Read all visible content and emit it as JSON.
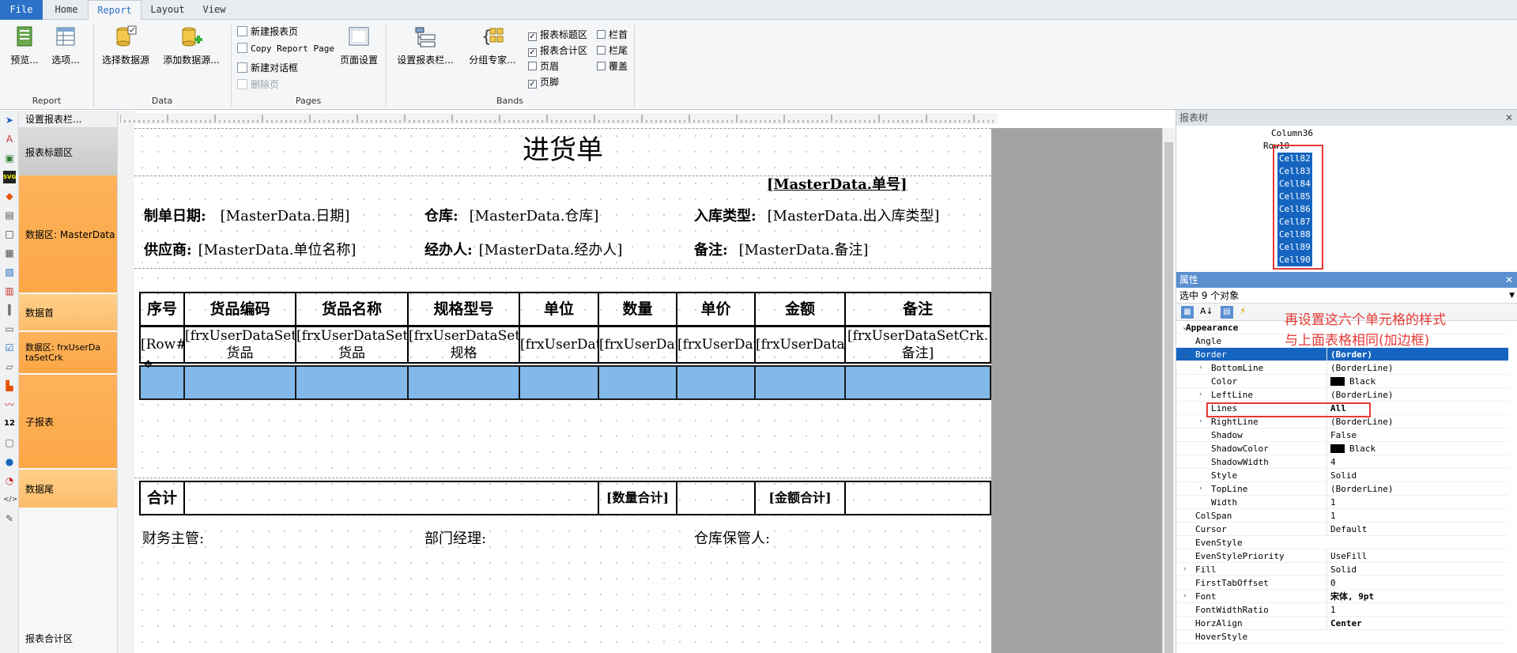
{
  "tabs": [
    {
      "label": "File",
      "state": "file"
    },
    {
      "label": "Home",
      "state": ""
    },
    {
      "label": "Report",
      "state": "active"
    },
    {
      "label": "Layout",
      "state": ""
    },
    {
      "label": "View",
      "state": ""
    }
  ],
  "ribbon": {
    "report_group": {
      "label": "Report",
      "preview": "预览...",
      "options": "选项..."
    },
    "data_group": {
      "label": "Data",
      "select_ds": "选择数据源",
      "add_ds": "添加数据源..."
    },
    "pages_group": {
      "label": "Pages",
      "new_page": "新建报表页",
      "copy_page": "Copy Report Page",
      "new_dialog": "新建对话框",
      "delete_page": "删除页",
      "page_setup": "页面设置"
    },
    "bands_group": {
      "label": "Bands",
      "config_bands": "设置报表栏...",
      "group_expert": "分组专家...",
      "checks": [
        {
          "label": "报表标题区",
          "checked": true
        },
        {
          "label": "报表合计区",
          "checked": true
        },
        {
          "label": "页眉",
          "checked": false
        },
        {
          "label": "页脚",
          "checked": true
        },
        {
          "label": "栏首",
          "checked": false
        },
        {
          "label": "栏尾",
          "checked": false
        },
        {
          "label": "覆盖",
          "checked": false
        }
      ]
    }
  },
  "bands_panel": {
    "header": "设置报表栏...",
    "items": [
      "报表标题区",
      "数据区: MasterData",
      "数据首",
      "数据区: frxUserDataSetCrk",
      "子报表",
      "数据尾",
      "报表合计区"
    ]
  },
  "report": {
    "title": "进货单",
    "order_no": "[MasterData.单号]",
    "row1": [
      {
        "label": "制单日期:",
        "value": "[MasterData.日期]"
      },
      {
        "label": "仓库:",
        "value": "[MasterData.仓库]"
      },
      {
        "label": "入库类型:",
        "value": "[MasterData.出入库类型]"
      }
    ],
    "row2": [
      {
        "label": "供应商:",
        "value": "[MasterData.单位名称]"
      },
      {
        "label": "经办人:",
        "value": "[MasterData.经办人]"
      },
      {
        "label": "备注:",
        "value": "[MasterData.备注]"
      }
    ],
    "headers": [
      "序号",
      "货品编码",
      "货品名称",
      "规格型号",
      "单位",
      "数量",
      "单价",
      "金额",
      "备注"
    ],
    "data_row": [
      "[Row#]",
      "[frxUserDataSetCrk.货品",
      "[frxUserDataSetCrk.货品",
      "[frxUserDataSetCrk.规格",
      "[frxUserDataSetC",
      "[frxUserDataSetC",
      "[frxUserDataSetC",
      "[frxUserDataSetCrk",
      "[frxUserDataSetCrk.备注]"
    ],
    "total_label": "合计",
    "total_qty": "[数量合计]",
    "total_amount": "[金额合计]",
    "footer": [
      "财务主管:",
      "部门经理:",
      "仓库保管人:"
    ]
  },
  "tree_panel": {
    "title": "报表树",
    "items": [
      "Column36",
      "Row10",
      "Cell82",
      "Cell83",
      "Cell84",
      "Cell85",
      "Cell86",
      "Cell87",
      "Cell88",
      "Cell89",
      "Cell90"
    ]
  },
  "props_panel": {
    "title": "属性",
    "selection": "选中 9 个对象",
    "rows": [
      {
        "name": "Appearance",
        "value": "",
        "kind": "cat"
      },
      {
        "name": "Angle",
        "value": "",
        "kind": ""
      },
      {
        "name": "Border",
        "value": "(Border)",
        "kind": "hl"
      },
      {
        "name": "BottomLine",
        "value": "(BorderLine)",
        "kind": "sub"
      },
      {
        "name": "Color",
        "value": "Black",
        "kind": "sub-color"
      },
      {
        "name": "LeftLine",
        "value": "(BorderLine)",
        "kind": "sub"
      },
      {
        "name": "Lines",
        "value": "All",
        "kind": "sub-bold"
      },
      {
        "name": "RightLine",
        "value": "(BorderLine)",
        "kind": "sub"
      },
      {
        "name": "Shadow",
        "value": "False",
        "kind": "sub"
      },
      {
        "name": "ShadowColor",
        "value": "Black",
        "kind": "sub-color"
      },
      {
        "name": "ShadowWidth",
        "value": "4",
        "kind": "sub"
      },
      {
        "name": "Style",
        "value": "Solid",
        "kind": "sub"
      },
      {
        "name": "TopLine",
        "value": "(BorderLine)",
        "kind": "sub"
      },
      {
        "name": "Width",
        "value": "1",
        "kind": "sub"
      },
      {
        "name": "ColSpan",
        "value": "1",
        "kind": ""
      },
      {
        "name": "Cursor",
        "value": "Default",
        "kind": ""
      },
      {
        "name": "EvenStyle",
        "value": "",
        "kind": ""
      },
      {
        "name": "EvenStylePriority",
        "value": "UseFill",
        "kind": ""
      },
      {
        "name": "Fill",
        "value": "Solid",
        "kind": ""
      },
      {
        "name": "FirstTabOffset",
        "value": "0",
        "kind": ""
      },
      {
        "name": "Font",
        "value": "宋体, 9pt",
        "kind": "bold"
      },
      {
        "name": "FontWidthRatio",
        "value": "1",
        "kind": ""
      },
      {
        "name": "HorzAlign",
        "value": "Center",
        "kind": "bold"
      },
      {
        "name": "HoverStyle",
        "value": "",
        "kind": ""
      }
    ]
  },
  "annotation": {
    "line1": "再设置这六个单元格的样式",
    "line2": "与上面表格相同(加边框)"
  }
}
